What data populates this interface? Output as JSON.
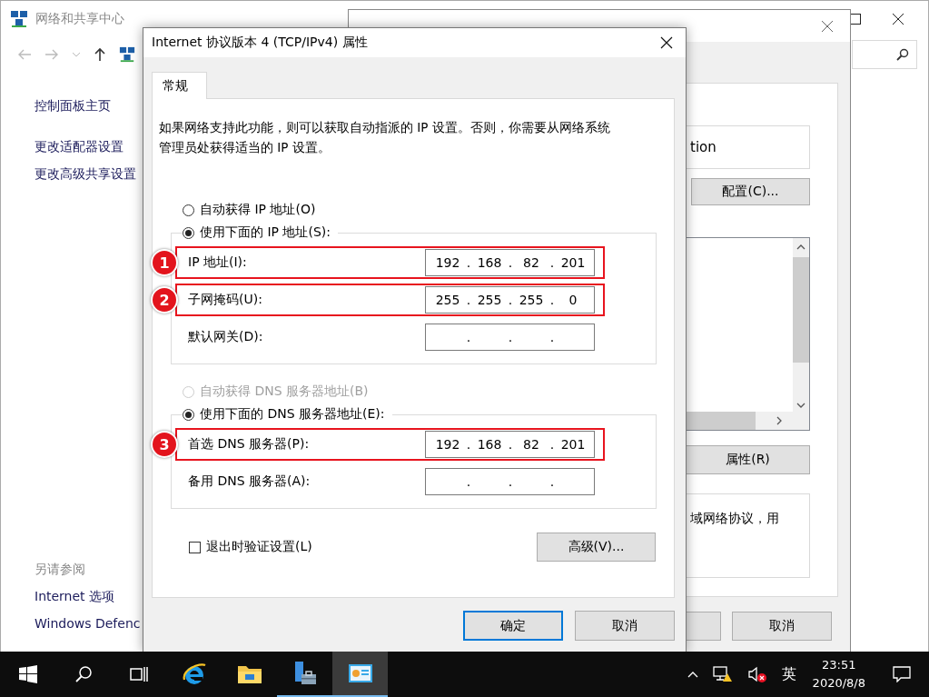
{
  "background_window": {
    "title": "网络和共享中心",
    "sidebar": {
      "items": [
        "控制面板主页",
        "更改适配器设置",
        "更改高级共享设置"
      ],
      "see_also_heading": "另请参阅",
      "see_also": [
        "Internet 选项",
        "Windows Defenc"
      ]
    }
  },
  "adapter_window": {
    "connection_name": "tion",
    "configure_button": "配置(C)...",
    "properties_button": "属性(R)",
    "description": "域网络协议，用",
    "cancel_button": "取消"
  },
  "dialog": {
    "title": "Internet 协议版本 4 (TCP/IPv4) 属性",
    "tabs": [
      {
        "label": "常规",
        "selected": true
      }
    ],
    "description": "如果网络支持此功能，则可以获取自动指派的 IP 设置。否则，你需要从网络系统管理员处获得适当的 IP 设置。",
    "ip_separator": ".",
    "ip_auto_option": {
      "label": "自动获得 IP 地址(O)",
      "selected": false,
      "disabled": false
    },
    "ip_group": {
      "option": {
        "label": "使用下面的 IP 地址(S):",
        "selected": true,
        "disabled": false
      },
      "fields": [
        {
          "label": "IP 地址(I):",
          "octets": [
            "192",
            "168",
            "82",
            "201"
          ],
          "marker": "1"
        },
        {
          "label": "子网掩码(U):",
          "octets": [
            "255",
            "255",
            "255",
            "0"
          ],
          "marker": "2"
        },
        {
          "label": "默认网关(D):"
        }
      ]
    },
    "dns_auto_option": {
      "label": "自动获得 DNS 服务器地址(B)",
      "selected": false,
      "disabled": true
    },
    "dns_group": {
      "option": {
        "label": "使用下面的 DNS 服务器地址(E):",
        "selected": true,
        "disabled": false
      },
      "fields": [
        {
          "label": "首选 DNS 服务器(P):",
          "octets": [
            "192",
            "168",
            "82",
            "201"
          ],
          "marker": "3"
        },
        {
          "label": "备用 DNS 服务器(A):"
        }
      ]
    },
    "validate_checkbox": {
      "label": "退出时验证设置(L)",
      "checked": false
    },
    "advanced_button": "高级(V)...",
    "buttons": [
      {
        "label": "确定",
        "default": true
      },
      {
        "label": "取消",
        "default": false
      }
    ]
  },
  "taskbar": {
    "apps": [
      {
        "kind": "ie",
        "running": false,
        "selected": false
      },
      {
        "kind": "explorer",
        "running": false,
        "selected": false
      },
      {
        "kind": "server-manager",
        "running": true,
        "selected": false
      },
      {
        "kind": "control-panel",
        "running": true,
        "selected": true
      }
    ],
    "language": "英",
    "time": "23:51",
    "date": "2020/8/8"
  }
}
